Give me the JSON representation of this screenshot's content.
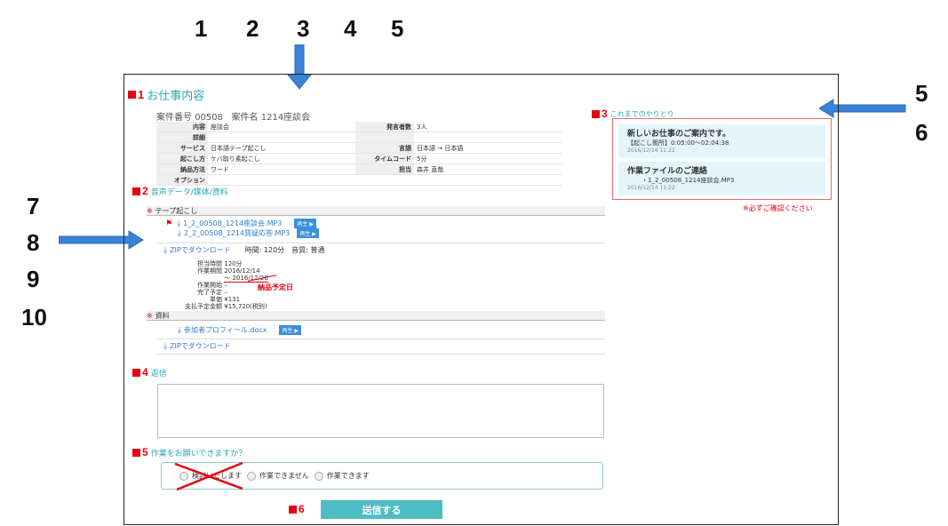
{
  "outside_numbers": [
    "1",
    "2",
    "3",
    "4",
    "5",
    "5",
    "6",
    "7",
    "8",
    "9",
    "10"
  ],
  "sec1": {
    "num": "1",
    "title": "お仕事内容"
  },
  "case": {
    "number_label": "案件番号",
    "number": "00508",
    "name_label": "案件名",
    "name": "1214座談会"
  },
  "info": {
    "naiyo_k": "内容",
    "naiyo_v": "座談会",
    "shosai_k": "詳細",
    "service_k": "サービス",
    "service_v": "日本語テープ起こし",
    "okoshi_k": "起こし方",
    "okoshi_v": "ケバ取り素起こし",
    "nohin_k": "納品方法",
    "nohin_v": "ワード",
    "option_k": "オプション",
    "speakers_k": "発言者数",
    "speakers_v": "3人",
    "lang_k": "言語",
    "lang_v": "日本語 → 日本語",
    "timecode_k": "タイムコード",
    "timecode_v": "5分",
    "tanto_k": "担当",
    "tanto_v": "森井 直哉"
  },
  "sec2": {
    "num": "2",
    "title": "音声データ/媒体/資料"
  },
  "tape": {
    "mark": "※",
    "label": "テープ起こし",
    "file1": "1_2_00508_1214座談会.MP3",
    "file2": "2_2_00508_1214質疑応答.MP3",
    "play": "再生 ▶",
    "zip": "ZIPでダウンロード",
    "time": "時間: 120分",
    "quality": "音質: 普通"
  },
  "detail": {
    "tanto_time_k": "担当時間",
    "tanto_time_v": "120分",
    "work_k": "作業期間",
    "work_v1": "2016/12/14",
    "work_v2": "〜 2016/12/28",
    "start_k": "作業開始",
    "start_v": "–",
    "finish_k": "完了予定",
    "finish_v": "–",
    "nohin_note": "納品予定日",
    "tanka_k": "単価",
    "tanka_v": "¥131",
    "total_k": "支払予定金額",
    "total_v": "¥15,720(税別)"
  },
  "shiryo": {
    "mark": "※",
    "label": "資料",
    "file": "参加者プロフィール.docx",
    "play": "再生 ▶",
    "zip": "ZIPでダウンロード"
  },
  "sec3": {
    "num": "3",
    "title": "これまでのやりとり"
  },
  "messages": [
    {
      "title": "新しいお仕事のご案内です。",
      "body": "【起こし箇所】0:05:00〜02:04:38",
      "date": "2016/12/14 11:22"
    },
    {
      "title": "作業ファイルのご連絡",
      "body": "・1_2_00508_1214座談会.MP3",
      "date": "2016/12/14 11:22"
    }
  ],
  "confirm_note": "※必ずご確認ください",
  "sec4": {
    "num": "4",
    "title": "返信"
  },
  "sec5": {
    "num": "5",
    "title": "作業をお願いできますか？"
  },
  "radios": {
    "opt1": "検討いたします",
    "opt2": "作業できません",
    "opt3": "作業できます"
  },
  "sec6": {
    "num": "6"
  },
  "submit_label": "送信する",
  "colors": {
    "accent": "#e60012",
    "teal": "#2aa9b8",
    "button": "#4dbdc4",
    "link": "#2b7fd1"
  }
}
